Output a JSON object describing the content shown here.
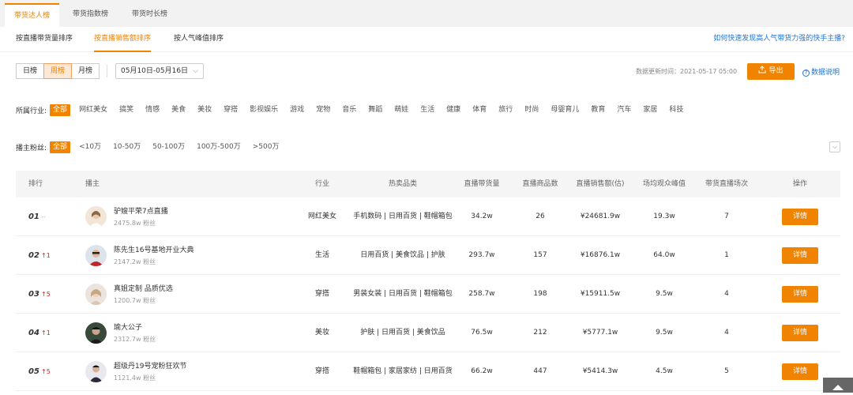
{
  "tabs": [
    "带货达人榜",
    "带货指数榜",
    "带货时长榜"
  ],
  "subtabs": [
    "按直播带货量排序",
    "按直播销售额排序",
    "按人气峰值排序"
  ],
  "help_link": "如何快速发现高人气带货力强的快手主播?",
  "periods": [
    "日榜",
    "周榜",
    "月榜"
  ],
  "date_range": "05月10日-05月16日",
  "update_time": "数据更新时间：2021-05-17 05:00",
  "export_label": "导出",
  "data_help": "数据说明",
  "industry": {
    "label": "所属行业:",
    "options": [
      "全部",
      "网红美女",
      "搞笑",
      "情感",
      "美食",
      "美妆",
      "穿搭",
      "影视娱乐",
      "游戏",
      "宠物",
      "音乐",
      "舞蹈",
      "萌娃",
      "生活",
      "健康",
      "体育",
      "旅行",
      "时尚",
      "母婴育儿",
      "教育",
      "汽车",
      "家居",
      "科技"
    ]
  },
  "fans": {
    "label": "播主粉丝:",
    "options": [
      "全部",
      "<10万",
      "10-50万",
      "50-100万",
      "100万-500万",
      ">500万"
    ]
  },
  "headers": [
    "排行",
    "播主",
    "行业",
    "热卖品类",
    "直播带货量",
    "直播商品数",
    "直播销售额(估)",
    "场均观众峰值",
    "带货直播场次",
    "操作"
  ],
  "rows": [
    {
      "rank": "01",
      "trend": "--",
      "name": "驴嫂平荣7点直播",
      "fans": "2475.8w 粉丝",
      "industry": "网红美女",
      "categories": "手机数码 | 日用百货 | 鞋帽箱包",
      "volume": "34.2w",
      "products": "26",
      "sales": "¥24681.9w",
      "peak": "19.3w",
      "sessions": "7",
      "action": "详情"
    },
    {
      "rank": "02",
      "trend": "↑1",
      "name": "陈先生16号基地开业大典",
      "fans": "2147.2w 粉丝",
      "industry": "生活",
      "categories": "日用百货 | 美食饮品 | 护肤",
      "volume": "293.7w",
      "products": "157",
      "sales": "¥16876.1w",
      "peak": "64.0w",
      "sessions": "1",
      "action": "详情"
    },
    {
      "rank": "03",
      "trend": "↑5",
      "name": "真姐定制 品质优选",
      "fans": "1200.7w 粉丝",
      "industry": "穿搭",
      "categories": "男装女装 | 日用百货 | 鞋帽箱包",
      "volume": "258.7w",
      "products": "198",
      "sales": "¥15911.5w",
      "peak": "9.5w",
      "sessions": "4",
      "action": "详情"
    },
    {
      "rank": "04",
      "trend": "↑1",
      "name": "瑜大公子",
      "fans": "2312.7w 粉丝",
      "industry": "美妆",
      "categories": "护肤 | 日用百货 | 美食饮品",
      "volume": "76.5w",
      "products": "212",
      "sales": "¥5777.1w",
      "peak": "9.5w",
      "sessions": "4",
      "action": "详情"
    },
    {
      "rank": "05",
      "trend": "↑5",
      "name": "超级丹19号宠粉狂欢节",
      "fans": "1121.4w 粉丝",
      "industry": "穿搭",
      "categories": "鞋帽箱包 | 家居家纺 | 日用百货",
      "volume": "66.2w",
      "products": "447",
      "sales": "¥5414.3w",
      "peak": "4.5w",
      "sessions": "5",
      "action": "详情"
    }
  ],
  "colors": {
    "accent": "#f08300",
    "link": "#1e73d8",
    "up": "#e02020"
  }
}
